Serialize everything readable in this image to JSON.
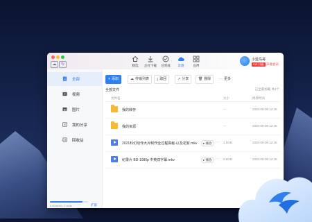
{
  "colors": {
    "accent": "#2f80ed",
    "folder": "#f7b835",
    "video": "#4d7cf0",
    "badge": "#f23f3f"
  },
  "titlebar": {
    "nav_tabs": [
      {
        "label": "精选",
        "icon": "home-icon"
      },
      {
        "label": "正在下载",
        "icon": "download-icon"
      },
      {
        "label": "已完成",
        "icon": "check-circle-icon"
      },
      {
        "label": "云盘",
        "icon": "cloud-icon"
      },
      {
        "label": "应用",
        "icon": "grid-icon"
      }
    ],
    "active_tab": "云盘",
    "brand": {
      "name": "小蓝鸟哥",
      "badge": "VIP 升级",
      "vip_text": "升级会员"
    }
  },
  "sidebar": {
    "items": [
      {
        "label": "全部",
        "icon": "document-icon"
      },
      {
        "label": "视频",
        "icon": "video-icon"
      },
      {
        "label": "图片",
        "icon": "image-icon"
      },
      {
        "label": "我的分享",
        "icon": "share-icon"
      },
      {
        "label": "回收站",
        "icon": "trash-icon"
      }
    ],
    "active_item": "全部",
    "quota": {
      "text": "0.00/5GB / 2.0GB",
      "link": "扩容",
      "used_fraction": 0.85
    }
  },
  "toolbar": {
    "add": "添加",
    "transfer": "传输列表",
    "retrieve": "取回",
    "share": "分享",
    "delete": "删除",
    "more": "更多"
  },
  "content": {
    "breadcrumb": "全部文件",
    "load_info": "已全部加载 共4个",
    "columns": {
      "name": "文件名",
      "size": "大小",
      "modified": "修改时间"
    },
    "files": [
      {
        "name": "我的转存",
        "type": "folder",
        "size": "---",
        "date": "2020-06-08 12:45"
      },
      {
        "name": "我的资源",
        "type": "folder",
        "size": "---",
        "date": "2020-06-08 12:45"
      },
      {
        "name": "2021科幻动作大片制作全过程揭秘-以及花絮.mkv",
        "type": "video",
        "play": "播放",
        "size": "1.5GB",
        "date": "2020-06-08 12:45"
      },
      {
        "name": "纪录片 BD-1080p 中英双字幕.mkv",
        "type": "video",
        "play": "播放",
        "size": "2.6GB",
        "date": "2020-06-08 12:45"
      }
    ]
  }
}
